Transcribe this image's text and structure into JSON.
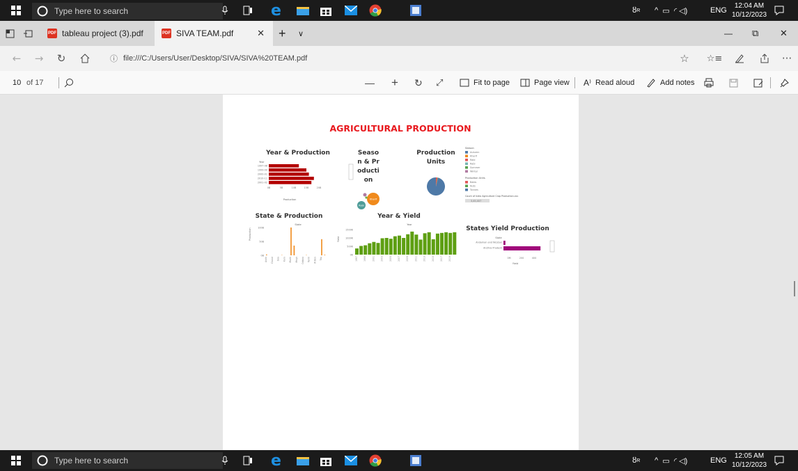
{
  "taskbar": {
    "search_placeholder": "Type here to search",
    "language": "ENG",
    "top_clock": {
      "time": "12:04 AM",
      "date": "10/12/2023"
    },
    "bottom_clock": {
      "time": "12:05 AM",
      "date": "10/12/2023"
    },
    "pinned_apps": [
      "task-view",
      "edge",
      "file-explorer",
      "store",
      "mail",
      "chrome",
      "word"
    ]
  },
  "browser": {
    "tabs": [
      {
        "label": "tableau project (3).pdf",
        "active": false
      },
      {
        "label": "SIVA TEAM.pdf",
        "active": true
      }
    ],
    "new_tab": "+",
    "tab_list": "∨",
    "window_controls": {
      "minimize": "—",
      "restore": "⧉",
      "close": "✕"
    },
    "address": "file:///C:/Users/User/Desktop/SIVA/SIVA%20TEAM.pdf",
    "menu_label": "···"
  },
  "pdf_toolbar": {
    "page_number": "10",
    "page_total": "of 17",
    "zoom_out": "—",
    "zoom_in": "+",
    "fit_to_page": "Fit to page",
    "page_view": "Page view",
    "read_aloud": "Read aloud",
    "add_notes": "Add notes"
  },
  "pdf_page": {
    "title": "AGRICULTURAL PRODUCTION",
    "panels": {
      "year_production": {
        "title": "Year & Production",
        "axis_header": "Year",
        "x_label": "Production",
        "y_ticks": [
          "1997-98",
          "1999-00",
          "2000-01",
          "2010-11",
          "2001-02"
        ],
        "x_ticks": [
          "0B",
          "5B",
          "10B",
          "15B",
          "20B"
        ]
      },
      "season_production": {
        "title_lines": [
          "Seaso",
          "n & Pr",
          "oducti",
          "on"
        ],
        "bubble_labels": [
          "Kharif",
          "Rabi"
        ]
      },
      "production_units": {
        "title_lines": [
          "Production",
          "Units"
        ]
      },
      "legend": {
        "season_title": "Season",
        "seasons": [
          "Autumn",
          "Kharif",
          "Rabi",
          "Rabi",
          "Summer",
          "Winter"
        ],
        "units_title": "Production Units",
        "units": [
          "Bales",
          "Nuts",
          "Tonnes"
        ],
        "count_label": "Count of India Agriculture Crop Production.csv",
        "count_value": "3,45,407"
      },
      "state_production": {
        "title": "State & Production",
        "axis_header": "State",
        "y_label": "Production",
        "y_ticks": [
          "100B",
          "50B",
          "0B"
        ]
      },
      "year_yield": {
        "title": "Year & Yield",
        "axis_header": "Year",
        "y_label": "Yield",
        "y_ticks": [
          "1500K",
          "1000K",
          "500K",
          "0K"
        ]
      },
      "states_yield": {
        "title": "States Yield Production",
        "axis_header": "State",
        "states": [
          "Andaman and Nicobar",
          "Andhra Pradesh"
        ],
        "x_ticks": [
          "0M",
          "200",
          "400"
        ],
        "x_label": "Yield"
      }
    }
  },
  "chart_data": [
    {
      "type": "bar",
      "title": "Year & Production",
      "orientation": "horizontal",
      "categories": [
        "1997-98",
        "1999-00",
        "2000-01",
        "2010-11",
        "2001-02"
      ],
      "values": [
        12,
        15,
        16,
        18,
        17
      ],
      "xlabel": "Production",
      "ylabel": "Year",
      "color": "#b30000"
    },
    {
      "type": "bar",
      "title": "State & Production",
      "categories": [
        "Andh",
        "Bihar",
        "Chand",
        "Dadra",
        "Goa",
        "Gujar",
        "Karn",
        "Kerala",
        "Madh",
        "Mahar",
        "Megh",
        "Nagal",
        "Odisha",
        "Punja",
        "Tamil",
        "Uttar",
        "W Ben",
        "Sikkim",
        "Trip",
        "Uttara"
      ],
      "values": [
        3,
        0,
        0,
        0,
        0,
        1,
        0,
        0,
        100,
        35,
        0,
        0,
        0,
        1,
        0,
        0,
        0,
        0,
        58,
        2
      ],
      "ylabel": "Production",
      "xlabel": "State",
      "color": "#f08a1c"
    },
    {
      "type": "bar",
      "title": "Year & Yield",
      "categories": [
        "1997",
        "1998",
        "1999",
        "2000",
        "2001",
        "2002",
        "2003",
        "2004",
        "2005",
        "2006",
        "2007",
        "2008",
        "2009",
        "2010",
        "2011",
        "2012",
        "2013",
        "2014",
        "2015",
        "2016",
        "2017",
        "2018",
        "2019",
        "2020"
      ],
      "values": [
        370,
        520,
        560,
        680,
        760,
        700,
        980,
        1000,
        950,
        1100,
        1140,
        1000,
        1220,
        1380,
        1200,
        900,
        1280,
        1340,
        920,
        1260,
        1300,
        1340,
        1300,
        1340
      ],
      "ylabel": "Yield",
      "xlabel": "Year",
      "color": "#5e9f12"
    },
    {
      "type": "bar",
      "title": "States Yield Production",
      "orientation": "horizontal",
      "categories": [
        "Andaman and Nicobar",
        "Andhra Pradesh"
      ],
      "values": [
        20,
        380
      ],
      "xlabel": "Yield",
      "color": "#a0057a"
    },
    {
      "type": "pie",
      "title": "Production Units",
      "categories": [
        "Tonnes",
        "Nuts",
        "Bales"
      ],
      "values": [
        96,
        3,
        1
      ],
      "colors": [
        "#4e79a7",
        "#e15759",
        "#59a14f"
      ]
    }
  ]
}
